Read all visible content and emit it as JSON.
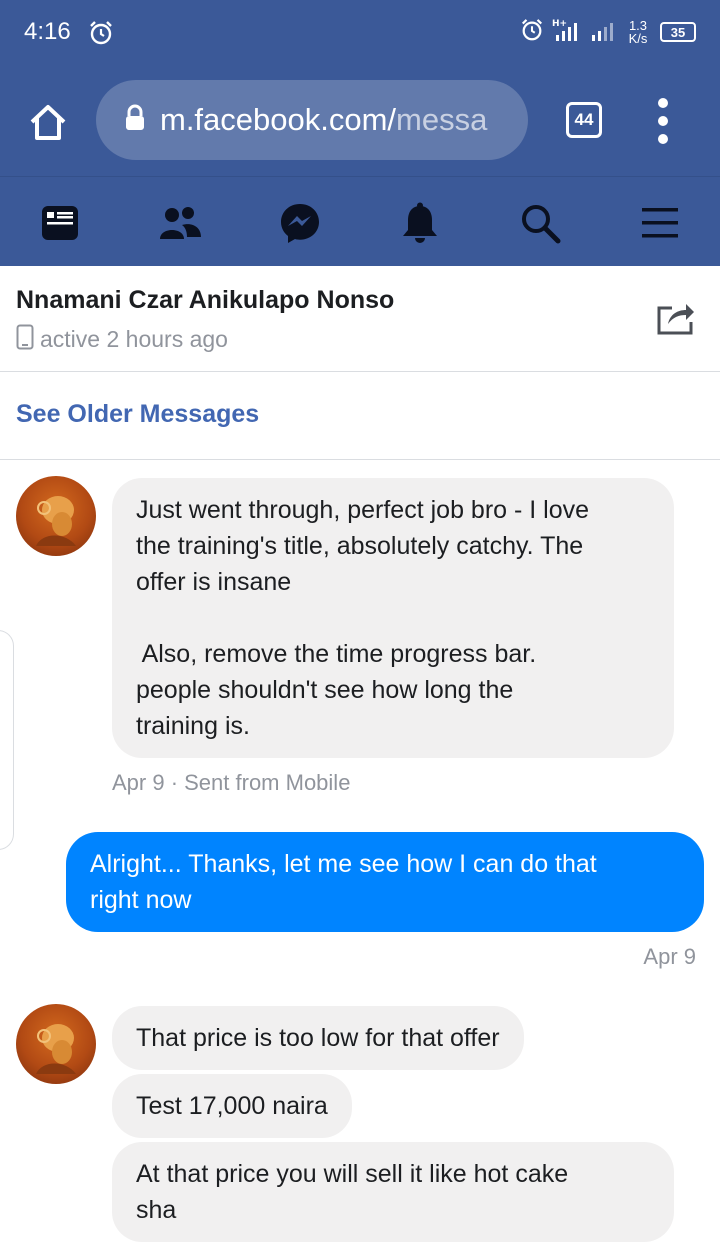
{
  "status_bar": {
    "time": "4:16",
    "net_speed_value": "1.3",
    "net_speed_unit": "K/s",
    "battery": "35"
  },
  "browser": {
    "url_host": "m.facebook.com/",
    "url_path": "messa",
    "tab_count": "44"
  },
  "nav": {
    "items": [
      "news-feed",
      "friends",
      "messenger",
      "notifications",
      "search",
      "menu"
    ]
  },
  "conversation": {
    "contact_name": "Nnamani Czar Anikulapo Nonso",
    "active_status": "active 2 hours ago",
    "see_older": "See Older Messages"
  },
  "messages": [
    {
      "direction": "incoming",
      "lines": [
        "Just went through, perfect job bro - I love",
        "the training's title, absolutely catchy. The",
        "offer is insane",
        "",
        " Also, remove the time progress bar.",
        "people shouldn't see how long the",
        "training is."
      ],
      "meta": "Apr 9 · Sent from Mobile"
    },
    {
      "direction": "outgoing",
      "lines": [
        "Alright... Thanks, let me see how I can do that",
        "right now"
      ],
      "meta": "Apr 9"
    },
    {
      "direction": "incoming",
      "lines": [
        "That price is too low for that offer"
      ]
    },
    {
      "direction": "incoming",
      "lines": [
        "Test 17,000 naira"
      ]
    },
    {
      "direction": "incoming",
      "lines": [
        "At that price you will sell it like hot cake",
        "sha"
      ]
    }
  ],
  "colors": {
    "facebook_blue": "#3b5998",
    "link_blue": "#4267b2",
    "outgoing_bubble": "#0084ff",
    "incoming_bubble": "#f1f0f0"
  }
}
